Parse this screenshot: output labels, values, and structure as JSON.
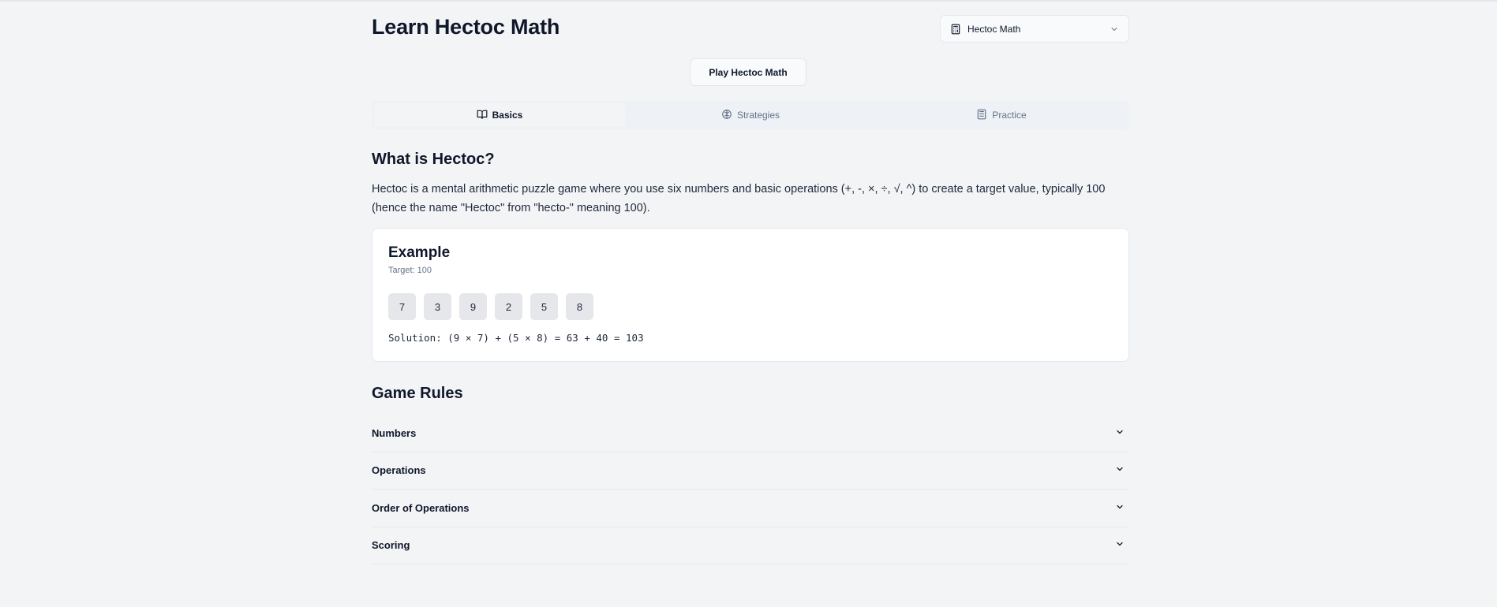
{
  "header": {
    "title": "Learn Hectoc Math",
    "select_value": "Hectoc Math",
    "select_icon": "calculator-icon"
  },
  "play_button": "Play Hectoc Math",
  "tabs": [
    {
      "label": "Basics",
      "icon": "book-open-icon",
      "active": true
    },
    {
      "label": "Strategies",
      "icon": "brain-icon",
      "active": false
    },
    {
      "label": "Practice",
      "icon": "calculator-icon",
      "active": false
    }
  ],
  "intro": {
    "heading": "What is Hectoc?",
    "text": "Hectoc is a mental arithmetic puzzle game where you use six numbers and basic operations (+, -, ×, ÷, √, ^) to create a target value, typically 100 (hence the name \"Hectoc\" from \"hecto-\" meaning 100)."
  },
  "example": {
    "title": "Example",
    "target": "Target: 100",
    "numbers": [
      "7",
      "3",
      "9",
      "2",
      "5",
      "8"
    ],
    "solution": "Solution: (9 × 7) + (5 × 8) = 63 + 40 = 103"
  },
  "rules": {
    "heading": "Game Rules",
    "items": [
      "Numbers",
      "Operations",
      "Order of Operations",
      "Scoring"
    ]
  },
  "colors": {
    "background": "#f3f4f6",
    "text": "#0f172a",
    "muted": "#64748b",
    "border": "#e2e8f0",
    "number_tile": "#e5e7eb"
  }
}
